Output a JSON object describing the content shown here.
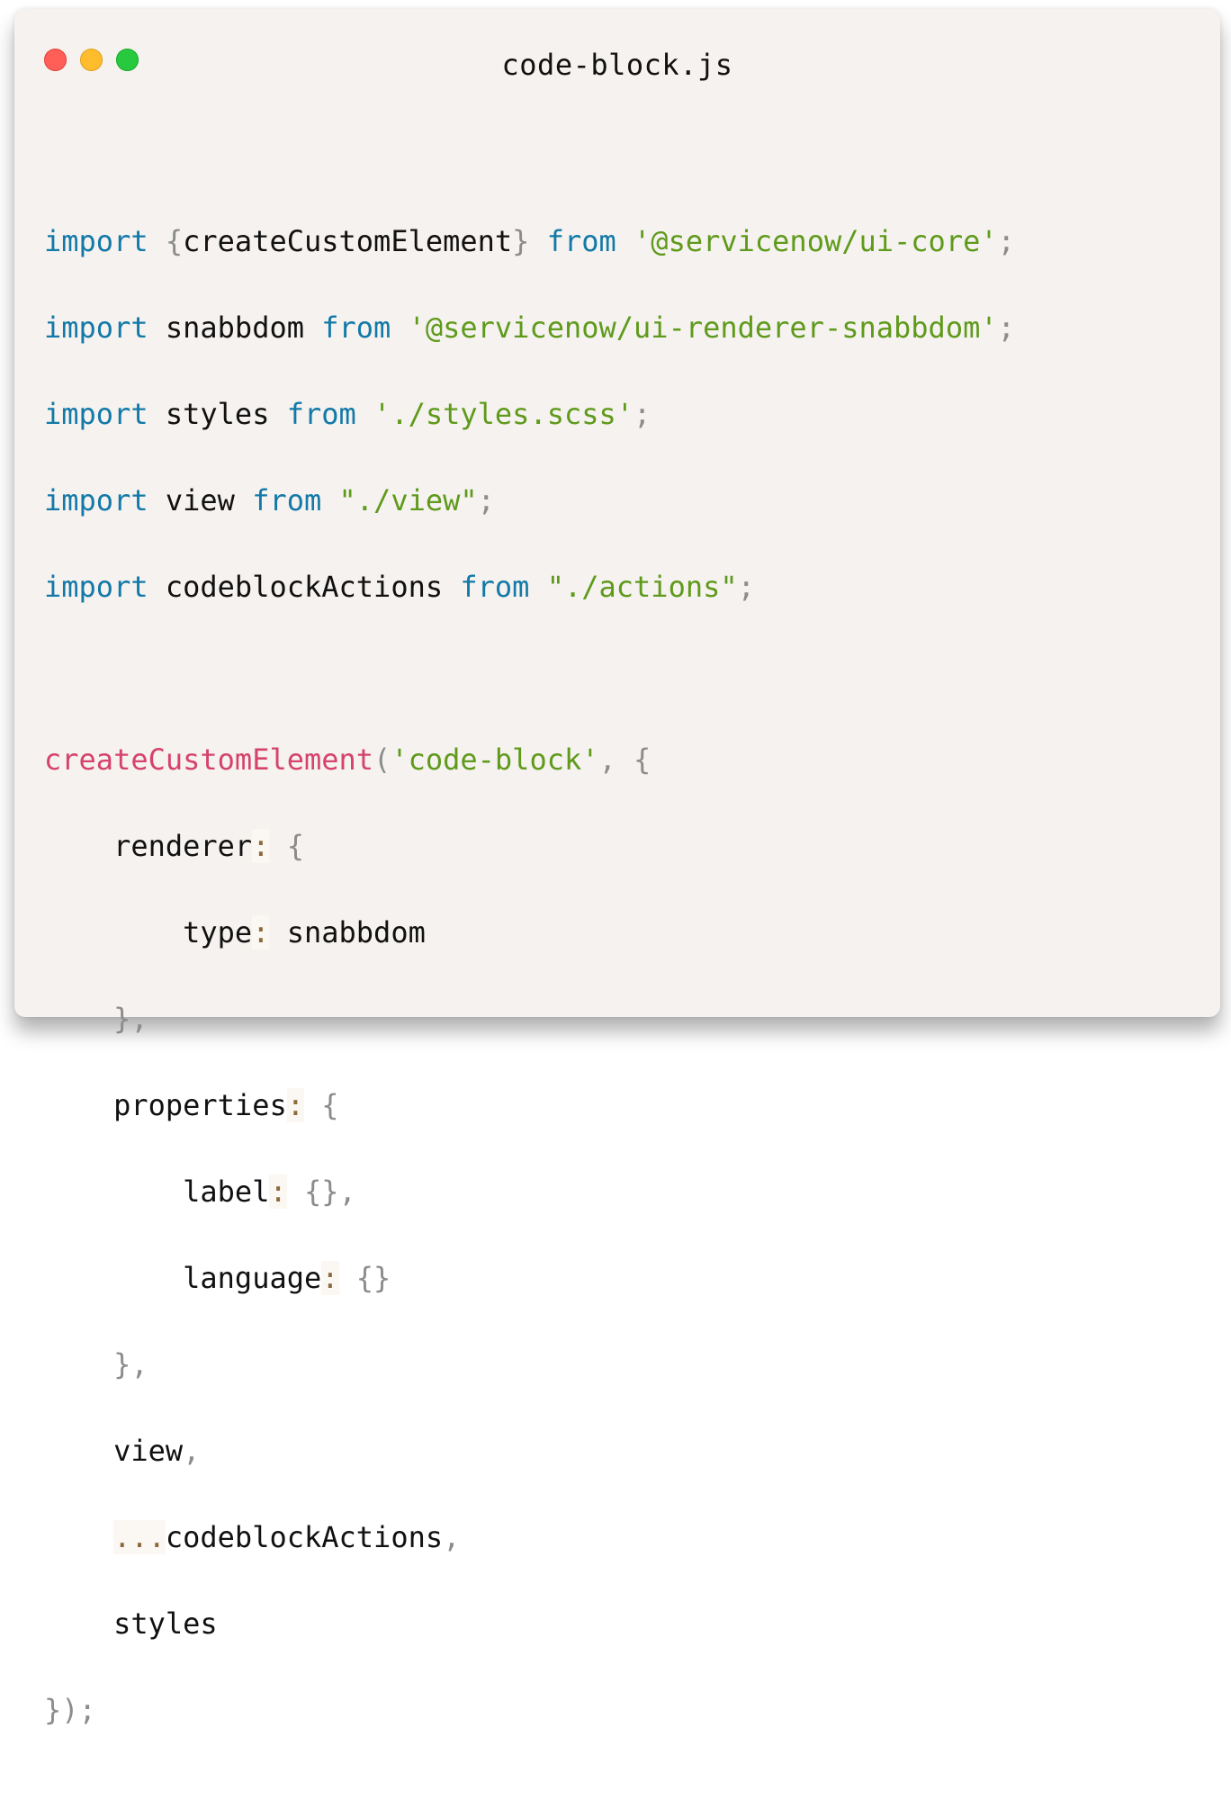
{
  "window": {
    "title": "code-block.js",
    "controls": {
      "close": "close-dot",
      "minimize": "minimize-dot",
      "maximize": "maximize-dot"
    },
    "colors": {
      "background": "#f5f2ef",
      "keyword": "#1279a8",
      "string": "#5f9a1b",
      "function": "#d6436a",
      "punctuation": "#8c8c8c"
    }
  },
  "code": {
    "l1": {
      "kw": "import",
      "open": "{",
      "ident": "createCustomElement",
      "close": "}",
      "from": "from",
      "str": "'@servicenow/ui-core'",
      "semi": ";"
    },
    "l2": {
      "kw": "import",
      "ident": "snabbdom",
      "from": "from",
      "str": "'@servicenow/ui-renderer-snabbdom'",
      "semi": ";"
    },
    "l3": {
      "kw": "import",
      "ident": "styles",
      "from": "from",
      "str": "'./styles.scss'",
      "semi": ";"
    },
    "l4": {
      "kw": "import",
      "ident": "view",
      "from": "from",
      "str": "\"./view\"",
      "semi": ";"
    },
    "l5": {
      "kw": "import",
      "ident": "codeblockActions",
      "from": "from",
      "str": "\"./actions\"",
      "semi": ";"
    },
    "l7": {
      "fn": "createCustomElement",
      "paren": "(",
      "str": "'code-block'",
      "comma": ",",
      "brace": "{"
    },
    "l8": {
      "indent": "    ",
      "key": "renderer",
      "colon": ":",
      "brace": "{"
    },
    "l9": {
      "indent": "        ",
      "key": "type",
      "colon": ":",
      "value": "snabbdom"
    },
    "l10": {
      "indent": "    ",
      "close": "},"
    },
    "l11": {
      "indent": "    ",
      "key": "properties",
      "colon": ":",
      "brace": "{"
    },
    "l12": {
      "indent": "        ",
      "key": "label",
      "colon": ":",
      "value": "{}",
      "comma": ","
    },
    "l13": {
      "indent": "        ",
      "key": "language",
      "colon": ":",
      "value": "{}"
    },
    "l14": {
      "indent": "    ",
      "close": "},"
    },
    "l15": {
      "indent": "    ",
      "ident": "view",
      "comma": ","
    },
    "l16": {
      "indent": "    ",
      "spread": "...",
      "ident": "codeblockActions",
      "comma": ","
    },
    "l17": {
      "indent": "    ",
      "ident": "styles"
    },
    "l18": {
      "close": "});"
    }
  }
}
